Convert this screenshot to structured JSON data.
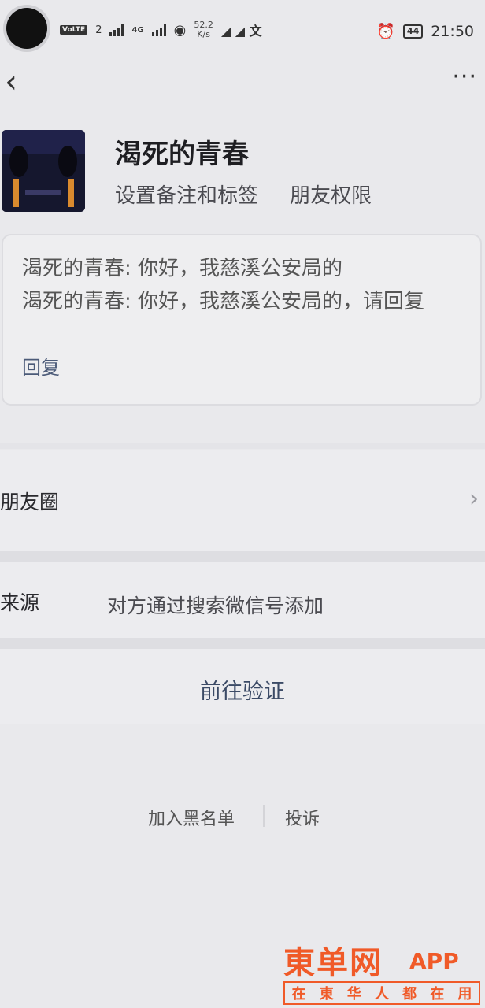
{
  "status_bar": {
    "volte": "VoLTE",
    "sim": "2",
    "network": "4G",
    "speed_value": "52.2",
    "speed_unit": "K/s",
    "battery": "44",
    "time": "21:50"
  },
  "nav": {
    "back_icon": "‹",
    "more_icon": "···"
  },
  "profile": {
    "name": "渴死的青春",
    "set_remark": "设置备注和标签",
    "friend_permission": "朋友权限"
  },
  "messages": [
    "渴死的青春: 你好，我慈溪公安局的",
    "渴死的青春: 你好，我慈溪公安局的，请回复"
  ],
  "reply_label": "回复",
  "moments": {
    "label": "朋友圈"
  },
  "source": {
    "label": "来源",
    "value": "对方通过搜索微信号添加"
  },
  "verify_button": "前往验证",
  "bottom_links": {
    "blacklist": "加入黑名单",
    "report": "投诉"
  },
  "watermark": {
    "title": "東单网",
    "app": "APP",
    "slogan": [
      "在",
      "東",
      "华",
      "人",
      "都",
      "在",
      "用"
    ]
  },
  "colors": {
    "background": "#e9e9ec",
    "link": "#4b5a78",
    "watermark": "#f05a28"
  }
}
